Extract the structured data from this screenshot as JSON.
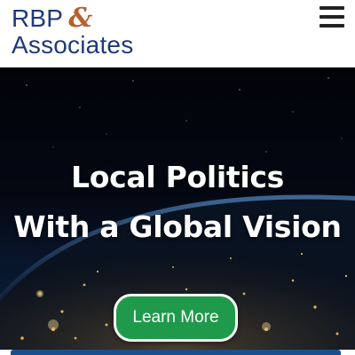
{
  "header": {
    "logo_line1": "RBP",
    "logo_amp": "&",
    "logo_line2": "Associates",
    "menu_icon": "hamburger-menu-icon"
  },
  "hero": {
    "headline_line1": "Local Politics",
    "headline_line2": "With a Global Vision",
    "cta_label": "Learn More",
    "background": "earth-at-night-from-space"
  },
  "colors": {
    "logo_text": "#1f3a7a",
    "logo_amp": "#b5622e",
    "cta_background": "#1e9a4a",
    "bottom_bar": "#1a4f8f"
  }
}
